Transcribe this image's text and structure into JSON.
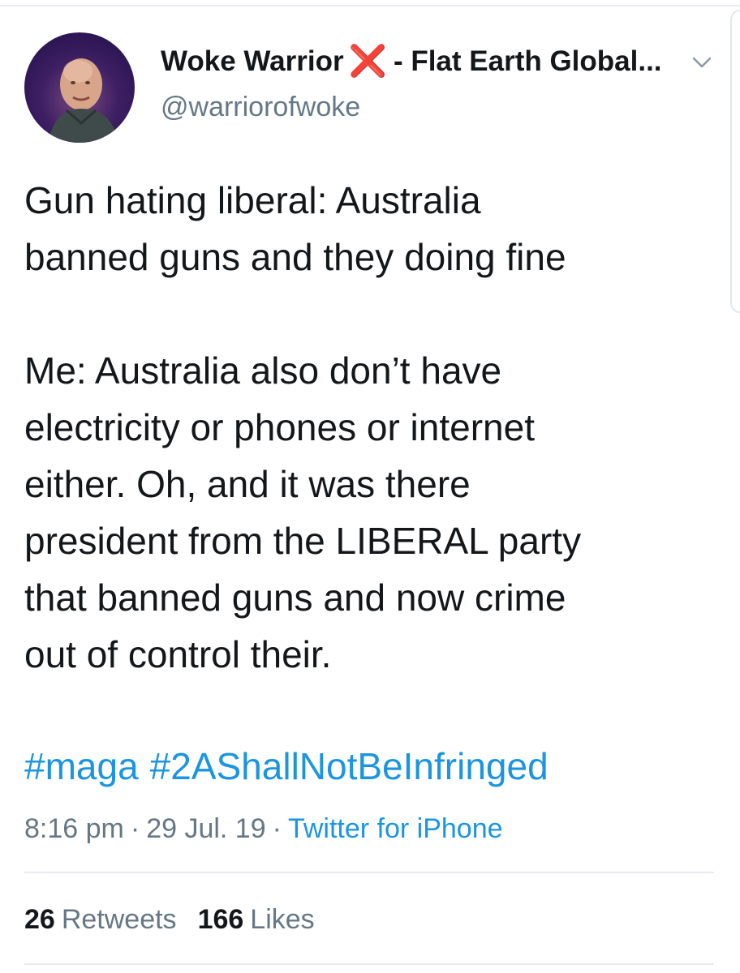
{
  "user": {
    "display_name": "Woke Warrior",
    "name_emoji": "❌",
    "name_suffix": "- Flat Earth Global...",
    "handle": "@warriorofwoke",
    "avatar_icon": "profile-photo"
  },
  "tweet": {
    "text": "Gun hating liberal: Australia\nbanned guns and they doing fine\n\nMe: Australia also don’t have\nelectricity or phones or internet\neither. Oh, and it was there\npresident from the LIBERAL party\nthat banned guns and now crime\nout of control their.",
    "hashtags": [
      "#maga",
      "#2AShallNotBeInfringed"
    ],
    "time": "8:16 pm",
    "date": "29 Jul. 19",
    "source": "Twitter for iPhone",
    "separator": "·"
  },
  "stats": {
    "retweets_count": "26",
    "retweets_label": "Retweets",
    "likes_count": "166",
    "likes_label": "Likes"
  },
  "colors": {
    "link": "#1b95e0",
    "secondary_text": "#657786",
    "primary_text": "#14171a",
    "x_mark": "#e0242b"
  }
}
